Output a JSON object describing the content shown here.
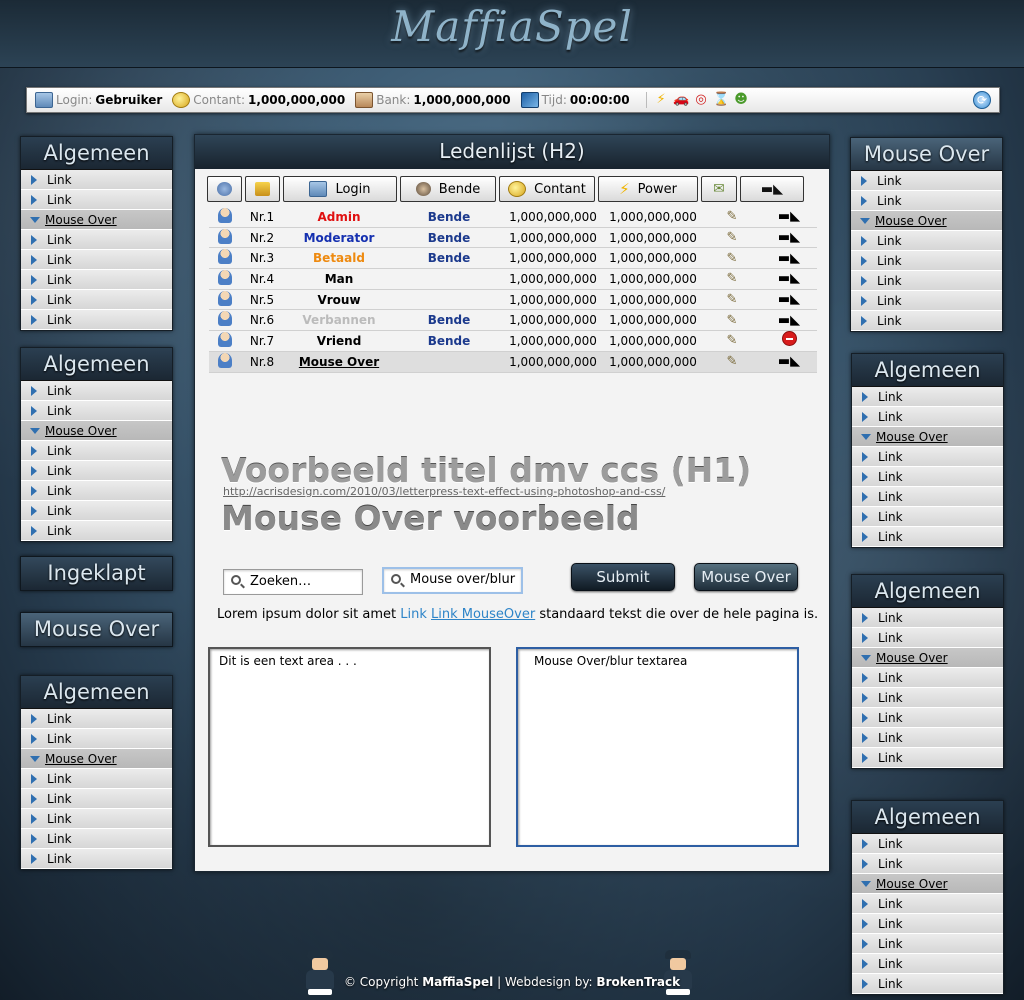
{
  "site": {
    "logo": "MaffiaSpel"
  },
  "status": {
    "login_label": "Login:",
    "login_value": "Gebruiker",
    "contant_label": "Contant:",
    "contant_value": "1,000,000,000",
    "bank_label": "Bank:",
    "bank_value": "1,000,000,000",
    "tijd_label": "Tijd:",
    "tijd_value": "00:00:00"
  },
  "left_menus": [
    {
      "title": "Algemeen",
      "items": [
        "Link",
        "Link",
        "Mouse Over",
        "Link",
        "Link",
        "Link",
        "Link",
        "Link"
      ],
      "active_index": 2
    },
    {
      "title": "Algemeen",
      "items": [
        "Link",
        "Link",
        "Mouse Over",
        "Link",
        "Link",
        "Link",
        "Link",
        "Link"
      ],
      "active_index": 2
    },
    {
      "title": "Ingeklapt"
    },
    {
      "title": "Mouse Over"
    },
    {
      "title": "Algemeen",
      "items": [
        "Link",
        "Link",
        "Mouse Over",
        "Link",
        "Link",
        "Link",
        "Link",
        "Link"
      ],
      "active_index": 2
    }
  ],
  "right_menus": [
    {
      "title": "Mouse Over",
      "items": [
        "Link",
        "Link",
        "Mouse Over",
        "Link",
        "Link",
        "Link",
        "Link",
        "Link"
      ],
      "active_index": 2
    },
    {
      "title": "Algemeen",
      "items": [
        "Link",
        "Link",
        "Mouse Over",
        "Link",
        "Link",
        "Link",
        "Link",
        "Link"
      ],
      "active_index": 2
    },
    {
      "title": "Algemeen",
      "items": [
        "Link",
        "Link",
        "Mouse Over",
        "Link",
        "Link",
        "Link",
        "Link",
        "Link"
      ],
      "active_index": 2
    },
    {
      "title": "Algemeen",
      "items": [
        "Link",
        "Link",
        "Mouse Over",
        "Link",
        "Link",
        "Link",
        "Link",
        "Link"
      ],
      "active_index": 2
    }
  ],
  "main": {
    "title": "Ledenlijst (H2)",
    "columns": {
      "login": "Login",
      "bende": "Bende",
      "contant": "Contant",
      "power": "Power"
    },
    "members": [
      {
        "nr": "Nr.1",
        "name": "Admin",
        "name_color": "#e01010",
        "bende": "Bende",
        "contant": "1,000,000,000",
        "power": "1,000,000,000",
        "action": "gun"
      },
      {
        "nr": "Nr.2",
        "name": "Moderator",
        "name_color": "#1530b0",
        "bende": "Bende",
        "contant": "1,000,000,000",
        "power": "1,000,000,000",
        "action": "gun"
      },
      {
        "nr": "Nr.3",
        "name": "Betaald",
        "name_color": "#ee8a10",
        "bende": "Bende",
        "contant": "1,000,000,000",
        "power": "1,000,000,000",
        "action": "gun"
      },
      {
        "nr": "Nr.4",
        "name": "Man",
        "name_color": "#000000",
        "bende": "",
        "contant": "1,000,000,000",
        "power": "1,000,000,000",
        "action": "gun"
      },
      {
        "nr": "Nr.5",
        "name": "Vrouw",
        "name_color": "#000000",
        "bende": "",
        "contant": "1,000,000,000",
        "power": "1,000,000,000",
        "action": "gun"
      },
      {
        "nr": "Nr.6",
        "name": "Verbannen",
        "name_color": "#bbbbbb",
        "bende": "Bende",
        "contant": "1,000,000,000",
        "power": "1,000,000,000",
        "action": "gun"
      },
      {
        "nr": "Nr.7",
        "name": "Vriend",
        "name_color": "#000000",
        "bende": "Bende",
        "contant": "1,000,000,000",
        "power": "1,000,000,000",
        "action": "block"
      },
      {
        "nr": "Nr.8",
        "name": "Mouse Over",
        "name_color": "#000000",
        "bende": "",
        "contant": "1,000,000,000",
        "power": "1,000,000,000",
        "action": "gun",
        "hover": true
      }
    ],
    "h1_title": "Voorbeeld titel dmv ccs (H1)",
    "h1_url": "http://acrisdesign.com/2010/03/letterpress-text-effect-using-photoshop-and-css/",
    "h1_hover": "Mouse Over voorbeeld",
    "search_placeholder": "Zoeken…",
    "search_focus_value": "Mouse over/blur",
    "submit_label": "Submit",
    "mouseover_btn_label": "Mouse Over",
    "lorem_before": "Lorem ipsum dolor sit amet",
    "lorem_link": "Link",
    "lorem_link_hover": "Link MouseOver",
    "lorem_after": "standaard tekst die over de hele pagina is.",
    "textarea_1": "Dit is een text area  . . .",
    "textarea_2": "Mouse Over/blur textarea"
  },
  "footer": {
    "prefix": "© Copyright",
    "brand": "MaffiaSpel",
    "middle": "| Webdesign by:",
    "designer": "BrokenTrack"
  },
  "colors": {
    "accent_link": "#2d84c8",
    "header_dark": "#1b2733",
    "admin": "#e01010",
    "moderator": "#1530b0",
    "paid": "#ee8a10",
    "banned": "#bbbbbb"
  }
}
